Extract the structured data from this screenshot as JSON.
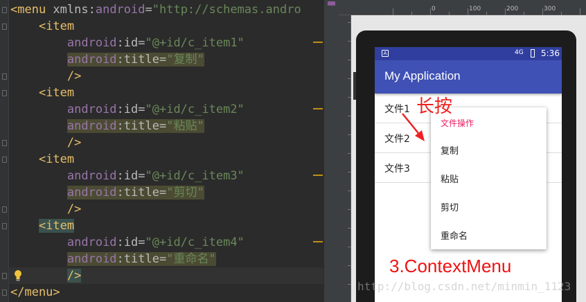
{
  "editor": {
    "lines": [
      {
        "parts": [
          [
            "tag",
            "<menu "
          ],
          [
            "attr",
            "xmlns:"
          ],
          [
            "ns",
            "android"
          ],
          [
            "attr",
            "="
          ],
          [
            "val",
            "\"http://schemas.andro"
          ]
        ]
      },
      {
        "indent": "    ",
        "parts": [
          [
            "tag",
            "<item"
          ]
        ]
      },
      {
        "indent": "        ",
        "parts": [
          [
            "ns",
            "android"
          ],
          [
            "attr",
            ":id="
          ],
          [
            "val",
            "\"@+id/c_item1\""
          ]
        ]
      },
      {
        "indent": "        ",
        "hl": true,
        "parts": [
          [
            "ns",
            "android"
          ],
          [
            "attr",
            ":title="
          ],
          [
            "val",
            "\"复制\""
          ]
        ]
      },
      {
        "indent": "        ",
        "parts": [
          [
            "tag",
            "/>"
          ]
        ]
      },
      {
        "indent": "    ",
        "parts": [
          [
            "tag",
            "<item"
          ]
        ]
      },
      {
        "indent": "        ",
        "parts": [
          [
            "ns",
            "android"
          ],
          [
            "attr",
            ":id="
          ],
          [
            "val",
            "\"@+id/c_item2\""
          ]
        ]
      },
      {
        "indent": "        ",
        "hl": true,
        "parts": [
          [
            "ns",
            "android"
          ],
          [
            "attr",
            ":title="
          ],
          [
            "val",
            "\"粘贴\""
          ]
        ]
      },
      {
        "indent": "        ",
        "parts": [
          [
            "tag",
            "/>"
          ]
        ]
      },
      {
        "indent": "    ",
        "parts": [
          [
            "tag",
            "<item"
          ]
        ]
      },
      {
        "indent": "        ",
        "parts": [
          [
            "ns",
            "android"
          ],
          [
            "attr",
            ":id="
          ],
          [
            "val",
            "\"@+id/c_item3\""
          ]
        ]
      },
      {
        "indent": "        ",
        "hl": true,
        "parts": [
          [
            "ns",
            "android"
          ],
          [
            "attr",
            ":title="
          ],
          [
            "val",
            "\"剪切\""
          ]
        ]
      },
      {
        "indent": "        ",
        "parts": [
          [
            "tag",
            "/>"
          ]
        ]
      },
      {
        "indent": "    ",
        "tagbox": true,
        "parts": [
          [
            "tag",
            "<item"
          ]
        ]
      },
      {
        "indent": "        ",
        "parts": [
          [
            "ns",
            "android"
          ],
          [
            "attr",
            ":id="
          ],
          [
            "val",
            "\"@+id/c_item4\""
          ]
        ]
      },
      {
        "indent": "        ",
        "hl": true,
        "parts": [
          [
            "ns",
            "android"
          ],
          [
            "attr",
            ":title="
          ],
          [
            "val",
            "\"重命名\""
          ]
        ]
      },
      {
        "indent": "        ",
        "tagbox2": true,
        "parts": [
          [
            "tag",
            "/>"
          ]
        ]
      },
      {
        "parts": [
          [
            "tag",
            "</menu>"
          ]
        ]
      }
    ]
  },
  "preview": {
    "ruler_labels": [
      "0",
      "100",
      "200",
      "300"
    ],
    "status_signal": "4G",
    "status_time": "5:36",
    "app_title": "My Application",
    "files": [
      "文件1",
      "文件2",
      "文件3"
    ],
    "context_menu": {
      "header": "文件操作",
      "items": [
        "复制",
        "粘贴",
        "剪切",
        "重命名"
      ]
    }
  },
  "annotations": {
    "long_press": "长按",
    "caption": "3.ContextMenu",
    "watermark": "http://blog.csdn.net/minmin_1123"
  },
  "colors": {
    "editor_bg": "#2b2b2b",
    "tag": "#e8bf6a",
    "namespace": "#9876aa",
    "string": "#6a8759",
    "app_bar": "#3f51b5",
    "status_bar": "#303f9f",
    "menu_header": "#e91e63",
    "annotation": "#ee2222"
  }
}
